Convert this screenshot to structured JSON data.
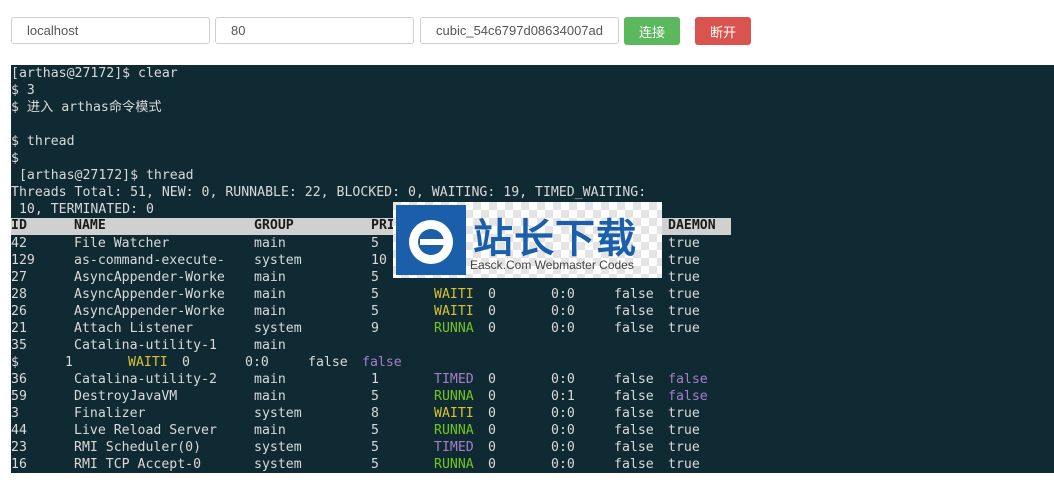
{
  "toolbar": {
    "host_value": "localhost",
    "port_value": "80",
    "agent_value": "cubic_54c6797d08634007ad0",
    "connect_label": "连接",
    "disconnect_label": "断开"
  },
  "terminal": {
    "pre_lines": [
      "[arthas@27172]$ clear",
      "$ 3",
      "$ 进入 arthas命令模式",
      "",
      "$ thread",
      "$",
      " [arthas@27172]$ thread",
      "Threads Total: 51, NEW: 0, RUNNABLE: 22, BLOCKED: 0, WAITING: 19, TIMED_WAITING:",
      " 10, TERMINATED: 0"
    ],
    "columns": [
      "ID",
      "NAME",
      "GROUP",
      "PRI",
      "STATE",
      "%CPU",
      "TIME",
      "INTERRUPTE",
      "DAEMON"
    ],
    "header_visible": {
      "id": "ID",
      "name": "NAME",
      "group": "GROUP",
      "pri": "PRI",
      "daemon": "DAEMON"
    },
    "rows": [
      {
        "id": "42",
        "name": "File Watcher",
        "group": "main",
        "pri": "5",
        "state": "",
        "cpu": "",
        "time": "",
        "interrupted": "",
        "daemon": "true"
      },
      {
        "id": "129",
        "name": "as-command-execute-",
        "group": "system",
        "pri": "10",
        "state": "",
        "cpu": "",
        "time": "",
        "interrupted": "",
        "daemon": "true"
      },
      {
        "id": "27",
        "name": "AsyncAppender-Worke",
        "group": "main",
        "pri": "5",
        "state": "",
        "cpu": "",
        "time": "",
        "interrupted": "",
        "daemon": "true"
      },
      {
        "id": "28",
        "name": "AsyncAppender-Worke",
        "group": "main",
        "pri": "5",
        "state": "WAITI",
        "cpu": "0",
        "time": "0:0",
        "interrupted": "false",
        "daemon": "true"
      },
      {
        "id": "26",
        "name": "AsyncAppender-Worke",
        "group": "main",
        "pri": "5",
        "state": "WAITI",
        "cpu": "0",
        "time": "0:0",
        "interrupted": "false",
        "daemon": "true"
      },
      {
        "id": "21",
        "name": "Attach Listener",
        "group": "system",
        "pri": "9",
        "state": "RUNNA",
        "cpu": "0",
        "time": "0:0",
        "interrupted": "false",
        "daemon": "true"
      },
      {
        "id": "35",
        "name": "Catalina-utility-1",
        "group": "main",
        "pri": "",
        "state": "",
        "cpu": "",
        "time": "",
        "interrupted": "",
        "daemon": ""
      }
    ],
    "wrap_line": {
      "prefix": "$",
      "pri": "1",
      "state": "WAITI",
      "cpu": "0",
      "time": "0:0",
      "interrupted": "false",
      "daemon": "false"
    },
    "rows2": [
      {
        "id": "36",
        "name": "Catalina-utility-2",
        "group": "main",
        "pri": "1",
        "state": "TIMED",
        "cpu": "0",
        "time": "0:0",
        "interrupted": "false",
        "daemon": "false"
      },
      {
        "id": "59",
        "name": "DestroyJavaVM",
        "group": "main",
        "pri": "5",
        "state": "RUNNA",
        "cpu": "0",
        "time": "0:1",
        "interrupted": "false",
        "daemon": "false"
      },
      {
        "id": "3",
        "name": "Finalizer",
        "group": "system",
        "pri": "8",
        "state": "WAITI",
        "cpu": "0",
        "time": "0:0",
        "interrupted": "false",
        "daemon": "true"
      },
      {
        "id": "44",
        "name": "Live Reload Server",
        "group": "main",
        "pri": "5",
        "state": "RUNNA",
        "cpu": "0",
        "time": "0:0",
        "interrupted": "false",
        "daemon": "true"
      },
      {
        "id": "23",
        "name": "RMI Scheduler(0)",
        "group": "system",
        "pri": "5",
        "state": "TIMED",
        "cpu": "0",
        "time": "0:0",
        "interrupted": "false",
        "daemon": "true"
      },
      {
        "id": "16",
        "name": "RMI TCP Accept-0",
        "group": "system",
        "pri": "5",
        "state": "RUNNA",
        "cpu": "0",
        "time": "0:0",
        "interrupted": "false",
        "daemon": "true"
      }
    ],
    "state_colors": {
      "WAITI": "#d8c22e",
      "RUNNA": "#73c41e",
      "TIMED": "#a67ec8"
    },
    "daemon_false_color": "#a67ec8"
  },
  "watermark": {
    "title": "站长下载",
    "subtitle": "Easck.Com Webmaster Codes",
    "brand_color": "#1b5ea9"
  }
}
